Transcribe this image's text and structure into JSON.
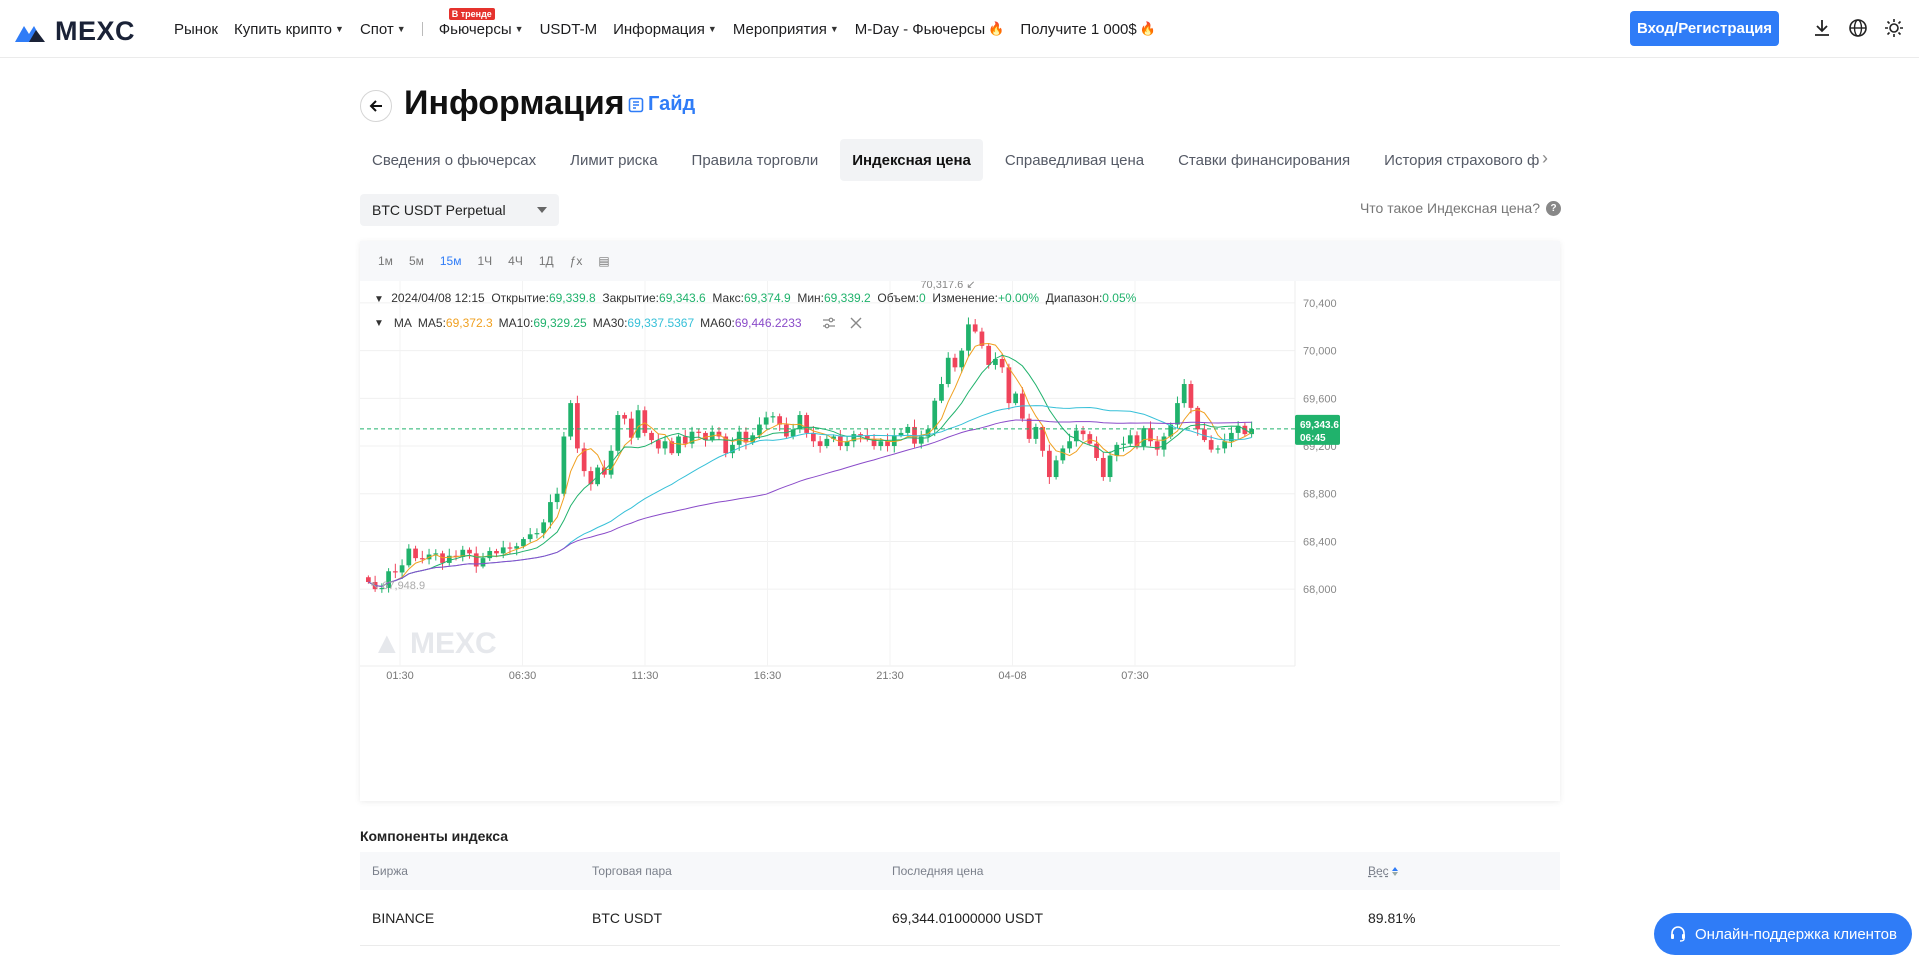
{
  "header": {
    "logo_text": "MEXC",
    "nav": [
      {
        "label": "Рынок",
        "caret": false
      },
      {
        "label": "Купить крипто",
        "caret": true
      },
      {
        "label": "Спот",
        "caret": true
      }
    ],
    "nav_right": [
      {
        "label": "Фьючерсы",
        "caret": true,
        "badge": "В тренде"
      },
      {
        "label": "USDT-M",
        "caret": false
      },
      {
        "label": "Информация",
        "caret": true
      },
      {
        "label": "Мероприятия",
        "caret": true
      },
      {
        "label": "M-Day - Фьючерсы",
        "caret": false,
        "fire": true
      },
      {
        "label": "Получите 1 000$",
        "caret": false,
        "fire": true
      }
    ],
    "login_label": "Вход/Регистрация",
    "accent": "#2f7cf7"
  },
  "page": {
    "title": "Информация",
    "guide_label": "Гайд"
  },
  "tabs": [
    {
      "label": "Сведения о фьючерсах",
      "active": false
    },
    {
      "label": "Лимит риска",
      "active": false
    },
    {
      "label": "Правила торговли",
      "active": false
    },
    {
      "label": "Индексная цена",
      "active": true
    },
    {
      "label": "Справедливая цена",
      "active": false
    },
    {
      "label": "Ставки финансирования",
      "active": false
    },
    {
      "label": "История страхового ф",
      "active": false
    }
  ],
  "selector": {
    "value": "BTC USDT Perpetual",
    "what_is_label": "Что такое Индексная цена?"
  },
  "chart_toolbar": {
    "timeframes": [
      "1м",
      "5м",
      "15м",
      "1Ч",
      "4Ч",
      "1Д"
    ],
    "active_timeframe": "15м"
  },
  "ohlc": {
    "datetime": "2024/04/08 12:15",
    "open_label": "Открытие:",
    "open": "69,339.8",
    "close_label": "Закрытие:",
    "close": "69,343.6",
    "high_label": "Макс:",
    "high": "69,374.9",
    "low_label": "Мин:",
    "low": "69,339.2",
    "volume_label": "Объем:",
    "volume": "0",
    "change_label": "Изменение:",
    "change": "+0.00%",
    "range_label": "Диапазон:",
    "range": "0.05%"
  },
  "ma": {
    "label": "MA",
    "ma5_label": "MA5:",
    "ma5": "69,372.3",
    "ma10_label": "MA10:",
    "ma10": "69,329.25",
    "ma30_label": "MA30:",
    "ma30": "69,337.5367",
    "ma60_label": "MA60:",
    "ma60": "69,446.2233",
    "colors": {
      "ma5": "#f0a020",
      "ma10": "#20b26c",
      "ma30": "#36c0d8",
      "ma60": "#8a4bc9"
    }
  },
  "chart_data": {
    "type": "candlestick",
    "y_ticks": [
      "70,400",
      "70,000",
      "69,600",
      "69,200",
      "68,800",
      "68,400",
      "68,000"
    ],
    "x_ticks": [
      "01:30",
      "06:30",
      "11:30",
      "16:30",
      "21:30",
      "04-08",
      "07:30"
    ],
    "ylim": [
      67800,
      70500
    ],
    "max_label": "70,317.6",
    "min_label": "67,948.9",
    "last_price": "69,343.6",
    "countdown": "06:45",
    "watermark": "MEXC",
    "up_color": "#20b26c",
    "down_color": "#f0445b",
    "close_series": [
      68060,
      68000,
      68010,
      68150,
      68140,
      68200,
      68340,
      68260,
      68250,
      68290,
      68300,
      68220,
      68280,
      68270,
      68330,
      68300,
      68190,
      68260,
      68320,
      68300,
      68350,
      68340,
      68360,
      68420,
      68460,
      68470,
      68560,
      68730,
      68800,
      69280,
      69560,
      69180,
      68990,
      68880,
      69020,
      68960,
      69160,
      69460,
      69430,
      69270,
      69500,
      69310,
      69250,
      69180,
      69240,
      69140,
      69280,
      69220,
      69320,
      69310,
      69250,
      69320,
      69280,
      69140,
      69210,
      69320,
      69230,
      69290,
      69380,
      69440,
      69450,
      69380,
      69280,
      69340,
      69460,
      69310,
      69240,
      69200,
      69260,
      69280,
      69200,
      69240,
      69300,
      69290,
      69260,
      69200,
      69240,
      69200,
      69290,
      69310,
      69360,
      69220,
      69280,
      69340,
      69580,
      69720,
      69940,
      69860,
      70000,
      70220,
      70160,
      70040,
      69880,
      69930,
      69860,
      69560,
      69640,
      69430,
      69260,
      69360,
      69160,
      68940,
      69080,
      69180,
      69240,
      69330,
      69300,
      69220,
      69100,
      68940,
      69120,
      69210,
      69220,
      69290,
      69200,
      69350,
      69240,
      69170,
      69280,
      69380,
      69560,
      69720,
      69520,
      69340,
      69250,
      69170,
      69180,
      69240,
      69310,
      69370,
      69300,
      69343
    ]
  },
  "components": {
    "title": "Компоненты индекса",
    "headers": [
      "Биржа",
      "Торговая пара",
      "Последняя цена",
      "Вес"
    ],
    "rows": [
      {
        "exchange": "BINANCE",
        "pair": "BTC USDT",
        "price": "69,344.01000000 USDT",
        "weight": "89.81%"
      }
    ]
  },
  "support_label": "Онлайн-поддержка клиентов"
}
